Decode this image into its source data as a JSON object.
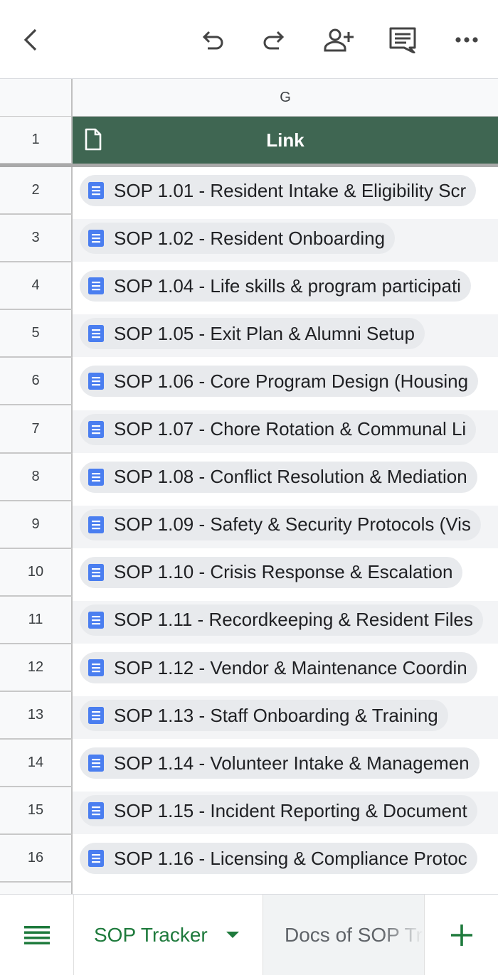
{
  "toolbar": {
    "back_icon": "chevron-left-icon",
    "undo_icon": "undo-icon",
    "redo_icon": "redo-icon",
    "share_icon": "person-add-icon",
    "comment_icon": "comment-icon",
    "more_icon": "more-horizontal-icon"
  },
  "grid": {
    "column_letter": "G",
    "header_row_number": "1",
    "header_label": "Link",
    "header_color": "#3f6652",
    "rows": [
      {
        "num": "2",
        "text": "SOP 1.01 - Resident Intake & Eligibility Scr"
      },
      {
        "num": "3",
        "text": "SOP 1.02 - Resident Onboarding"
      },
      {
        "num": "4",
        "text": "SOP 1.04 - Life skills & program participati"
      },
      {
        "num": "5",
        "text": "SOP 1.05 - Exit Plan & Alumni Setup"
      },
      {
        "num": "6",
        "text": "SOP 1.06 - Core Program Design (Housing"
      },
      {
        "num": "7",
        "text": "SOP 1.07 - Chore Rotation & Communal Li"
      },
      {
        "num": "8",
        "text": "SOP 1.08 - Conflict Resolution & Mediation"
      },
      {
        "num": "9",
        "text": "SOP 1.09 - Safety & Security Protocols (Vis"
      },
      {
        "num": "10",
        "text": "SOP 1.10 - Crisis Response & Escalation"
      },
      {
        "num": "11",
        "text": "SOP 1.11 - Recordkeeping & Resident Files"
      },
      {
        "num": "12",
        "text": "SOP 1.12 - Vendor & Maintenance Coordin"
      },
      {
        "num": "13",
        "text": "SOP 1.13 - Staff Onboarding & Training"
      },
      {
        "num": "14",
        "text": "SOP 1.14 - Volunteer Intake & Managemen"
      },
      {
        "num": "15",
        "text": "SOP 1.15 - Incident Reporting & Document"
      },
      {
        "num": "16",
        "text": "SOP 1.16 - Licensing & Compliance Protoc"
      }
    ]
  },
  "tabs": {
    "menu_icon": "sheet-list-icon",
    "active_label": "SOP Tracker",
    "inactive_label": "Docs of SOP Tr",
    "add_icon": "plus-icon",
    "accent_color": "#1e7a3c"
  }
}
